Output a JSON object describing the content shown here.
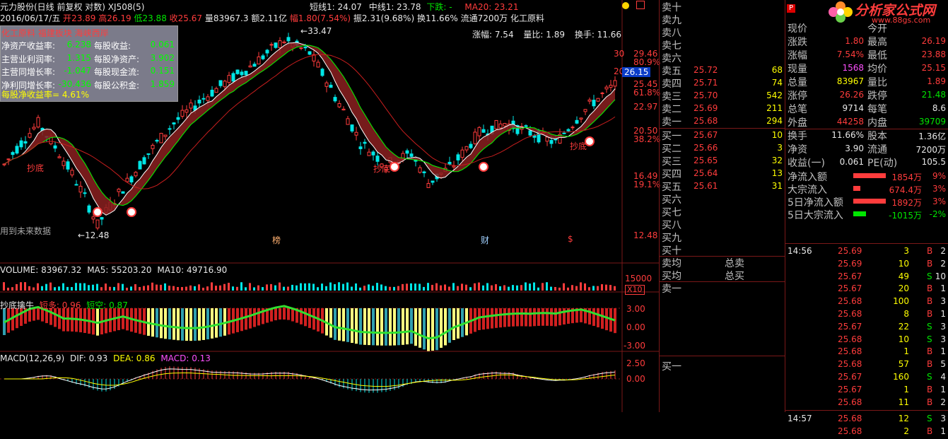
{
  "header": {
    "title": "元力股份(日线 前复权 对数) XJ508(5)",
    "date": "2016/06/17/五",
    "open_label": "开",
    "open": "23.89",
    "high_label": "高",
    "high": "26.19",
    "low_label": "低",
    "low": "23.88",
    "close_label": "收",
    "close": "25.67",
    "volume": "量83967.3",
    "amount": "额2.11亿",
    "change_pct": "幅1.80(7.54%)",
    "amplitude": "振2.31(9.68%)",
    "turnover": "换11.66%",
    "float": "流通7200万",
    "industry": "化工原料",
    "short_line": "短线1: 24.07",
    "mid_line": "中线1: 23.78",
    "trend": "下跌: -",
    "ma20": "MA20: 23.21",
    "stats_zf": "涨幅: 7.54",
    "stats_lb": "量比: 1.89",
    "stats_hs": "换手: 11.66"
  },
  "finance": {
    "title": "化工原料 福建板块 海峡西岸",
    "rows": [
      {
        "l1": "净资产收益率:",
        "v1": "6.238",
        "l2": "每股收益:",
        "v2": "0.061"
      },
      {
        "l1": "主营业利润率:",
        "v1": "1.315",
        "l2": "每股净资产:",
        "v2": "3.902"
      },
      {
        "l1": "主营同增长率:",
        "v1": "-1.047",
        "l2": "每股现金流:",
        "v2": "0.151"
      },
      {
        "l1": "净利同增长率:",
        "v1": "-30.436",
        "l2": "每股公积金:",
        "v2": "1.859"
      }
    ],
    "footer": "每股净收益率= 4.61%"
  },
  "main_axis": {
    "labels": [
      "29.46",
      "80.9%",
      "25.45",
      "61.8%",
      "22.97",
      "20.50",
      "38.2%",
      "16.49",
      "19.1%",
      "12.48"
    ],
    "price_tag": "26.15",
    "ticks_30": "30",
    "ticks_20": "20"
  },
  "annotations": {
    "high": "33.47",
    "low": "12.48",
    "chaodi": "抄底",
    "future": "用到未来数据",
    "bang": "榜",
    "cai": "财",
    "dollar": "$"
  },
  "volume_panel": {
    "label": "VOLUME: 83967.32",
    "ma5": "MA5: 55203.20",
    "ma10": "MA10: 49716.90",
    "axis_top": "15000",
    "unit": "X10"
  },
  "osc_panel": {
    "label": "抄底擒牛",
    "duo": "短多: 0.96",
    "kong": "短空: 0.87",
    "axis": [
      "3.00",
      "0.00",
      "-3.00"
    ]
  },
  "macd_panel": {
    "label": "MACD(12,26,9)",
    "dif": "DIF: 0.93",
    "dea": "DEA: 0.86",
    "macd": "MACD: 0.13",
    "axis": [
      "2.50",
      "0.00"
    ]
  },
  "orderbook": {
    "sells": [
      {
        "label": "卖十",
        "price": "",
        "vol": ""
      },
      {
        "label": "卖九",
        "price": "",
        "vol": ""
      },
      {
        "label": "卖八",
        "price": "",
        "vol": ""
      },
      {
        "label": "卖七",
        "price": "",
        "vol": ""
      },
      {
        "label": "卖六",
        "price": "",
        "vol": ""
      },
      {
        "label": "卖五",
        "price": "25.72",
        "vol": "68"
      },
      {
        "label": "卖四",
        "price": "25.71",
        "vol": "74"
      },
      {
        "label": "卖三",
        "price": "25.70",
        "vol": "542"
      },
      {
        "label": "卖二",
        "price": "25.69",
        "vol": "211"
      },
      {
        "label": "卖一",
        "price": "25.68",
        "vol": "294"
      }
    ],
    "buys": [
      {
        "label": "买一",
        "price": "25.67",
        "vol": "10"
      },
      {
        "label": "买二",
        "price": "25.66",
        "vol": "3"
      },
      {
        "label": "买三",
        "price": "25.65",
        "vol": "32"
      },
      {
        "label": "买四",
        "price": "25.64",
        "vol": "13"
      },
      {
        "label": "买五",
        "price": "25.61",
        "vol": "31"
      },
      {
        "label": "买六",
        "price": "",
        "vol": ""
      },
      {
        "label": "买七",
        "price": "",
        "vol": ""
      },
      {
        "label": "买八",
        "price": "",
        "vol": ""
      },
      {
        "label": "买九",
        "price": "",
        "vol": ""
      },
      {
        "label": "买十",
        "price": "",
        "vol": ""
      }
    ],
    "avg_sell": "卖均",
    "avg_buy": "买均",
    "total_sell": "总卖",
    "total_buy": "总买",
    "sell1": "卖一",
    "buy1": "买一"
  },
  "logo": {
    "text": "分析家公式网",
    "url": "www.88gs.com",
    "badge": "P"
  },
  "quote": {
    "rows": [
      {
        "l1": "现价",
        "v1": "",
        "l2": "今开",
        "v2": ""
      },
      {
        "l1": "涨跌",
        "v1": "1.80",
        "l2": "最高",
        "v2": "26.19"
      },
      {
        "l1": "涨幅",
        "v1": "7.54%",
        "l2": "最低",
        "v2": "23.88"
      },
      {
        "l1": "现量",
        "v1": "1568",
        "l2": "均价",
        "v2": "25.15"
      },
      {
        "l1": "总量",
        "v1": "83967",
        "l2": "量比",
        "v2": "1.89"
      },
      {
        "l1": "涨停",
        "v1": "26.26",
        "l2": "跌停",
        "v2": "21.48"
      },
      {
        "l1": "总笔",
        "v1": "9714",
        "l2": "每笔",
        "v2": "8.6"
      },
      {
        "l1": "外盘",
        "v1": "44258",
        "l2": "内盘",
        "v2": "39709"
      },
      {
        "l1": "换手",
        "v1": "11.66%",
        "l2": "股本",
        "v2": "1.36亿"
      },
      {
        "l1": "净资",
        "v1": "3.90",
        "l2": "流通",
        "v2": "7200万"
      },
      {
        "l1": "收益(一)",
        "v1": "0.061",
        "l2": "PE(动)",
        "v2": "105.5"
      }
    ],
    "flows": [
      {
        "label": "净流入额",
        "value": "1854万",
        "pct": "9%"
      },
      {
        "label": "大宗流入",
        "value": "674.4万",
        "pct": "3%"
      },
      {
        "label": "5日净流入额",
        "value": "1892万",
        "pct": "3%"
      },
      {
        "label": "5日大宗流入",
        "value": "-1015万",
        "pct": "-2%"
      }
    ]
  },
  "ticks": [
    {
      "time": "14:56",
      "price": "25.69",
      "vol": "3",
      "bs": "B",
      "n": "2"
    },
    {
      "time": "",
      "price": "25.69",
      "vol": "10",
      "bs": "B",
      "n": "2"
    },
    {
      "time": "",
      "price": "25.67",
      "vol": "49",
      "bs": "S",
      "n": "10"
    },
    {
      "time": "",
      "price": "25.67",
      "vol": "20",
      "bs": "B",
      "n": "1"
    },
    {
      "time": "",
      "price": "25.68",
      "vol": "100",
      "bs": "B",
      "n": "3"
    },
    {
      "time": "",
      "price": "25.68",
      "vol": "8",
      "bs": "B",
      "n": "1"
    },
    {
      "time": "",
      "price": "25.67",
      "vol": "22",
      "bs": "S",
      "n": "3"
    },
    {
      "time": "",
      "price": "25.68",
      "vol": "10",
      "bs": "S",
      "n": "3"
    },
    {
      "time": "",
      "price": "25.68",
      "vol": "1",
      "bs": "B",
      "n": "1"
    },
    {
      "time": "",
      "price": "25.68",
      "vol": "57",
      "bs": "B",
      "n": "5"
    },
    {
      "time": "",
      "price": "25.67",
      "vol": "160",
      "bs": "S",
      "n": "4"
    },
    {
      "time": "",
      "price": "25.67",
      "vol": "1",
      "bs": "B",
      "n": "1"
    },
    {
      "time": "",
      "price": "25.68",
      "vol": "11",
      "bs": "B",
      "n": "2"
    },
    {
      "time": "14:57",
      "price": "25.68",
      "vol": "12",
      "bs": "S",
      "n": "3"
    },
    {
      "time": "",
      "price": "25.68",
      "vol": "2",
      "bs": "B",
      "n": "1"
    }
  ],
  "colors": {
    "up": "#ff3c3c",
    "down": "#00e6e6",
    "ma_red": "#c81e1e",
    "ribbon_fill": "#8b2020",
    "grid": "#7a1818"
  }
}
